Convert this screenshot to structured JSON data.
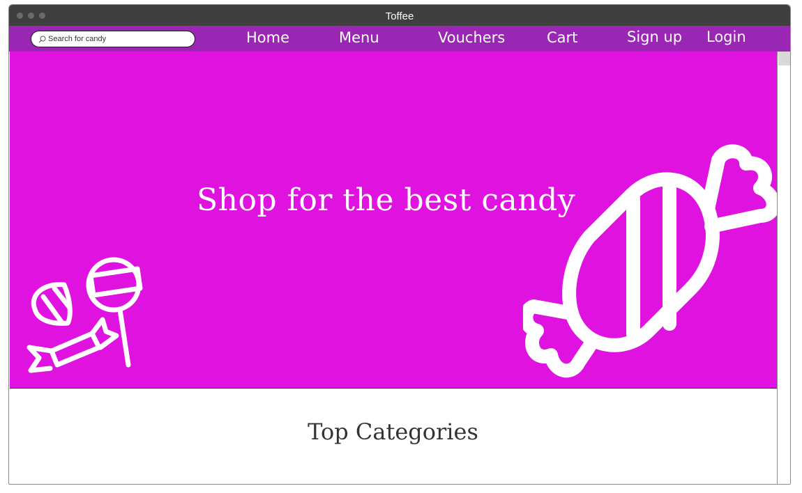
{
  "window": {
    "title": "Toffee"
  },
  "search": {
    "placeholder": "Search for candy"
  },
  "nav": {
    "home": "Home",
    "menu": "Menu",
    "vouchers": "Vouchers",
    "cart": "Cart",
    "signup": "Sign up",
    "login": "Login"
  },
  "hero": {
    "tagline": "Shop for the best candy"
  },
  "sections": {
    "top_categories": "Top Categories"
  },
  "colors": {
    "navbar": "#9a27b4",
    "hero_bg": "#df12e0",
    "titlebar": "#3f3f3f"
  }
}
